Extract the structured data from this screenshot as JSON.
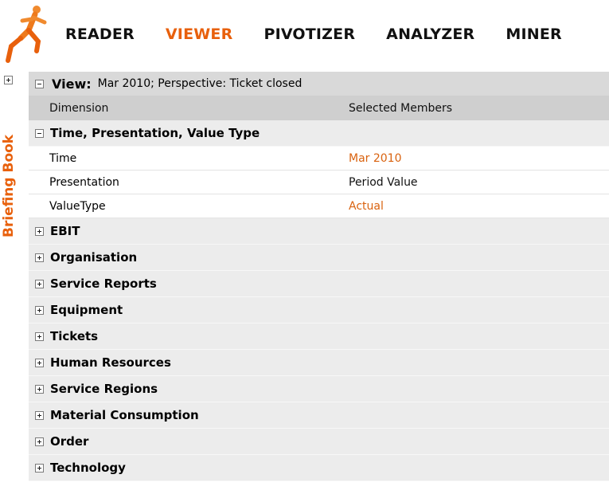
{
  "nav": {
    "items": [
      {
        "label": "READER",
        "active": false
      },
      {
        "label": "VIEWER",
        "active": true
      },
      {
        "label": "PIVOTIZER",
        "active": false
      },
      {
        "label": "ANALYZER",
        "active": false
      },
      {
        "label": "MINER",
        "active": false
      }
    ]
  },
  "sidebar": {
    "label": "Briefing Book"
  },
  "view": {
    "title": "View:",
    "description": "Mar 2010; Perspective: Ticket closed"
  },
  "columns": {
    "dimension": "Dimension",
    "selected": "Selected Members"
  },
  "expanded_group": {
    "label": "Time, Presentation, Value Type",
    "members": [
      {
        "dimension": "Time",
        "value": "Mar 2010",
        "link": true
      },
      {
        "dimension": "Presentation",
        "value": "Period Value",
        "link": false
      },
      {
        "dimension": "ValueType",
        "value": "Actual",
        "link": true
      }
    ]
  },
  "collapsed_groups": [
    "EBIT",
    "Organisation",
    "Service Reports",
    "Equipment",
    "Tickets",
    "Human Resources",
    "Service Regions",
    "Material Consumption",
    "Order",
    "Technology"
  ],
  "colors": {
    "accent": "#e8600c",
    "header_bg": "#d9d9d9",
    "group_bg": "#ececec"
  },
  "icons": {
    "logo": "runner-logo-icon",
    "expand": "plus-box-icon",
    "collapse": "minus-box-icon"
  }
}
